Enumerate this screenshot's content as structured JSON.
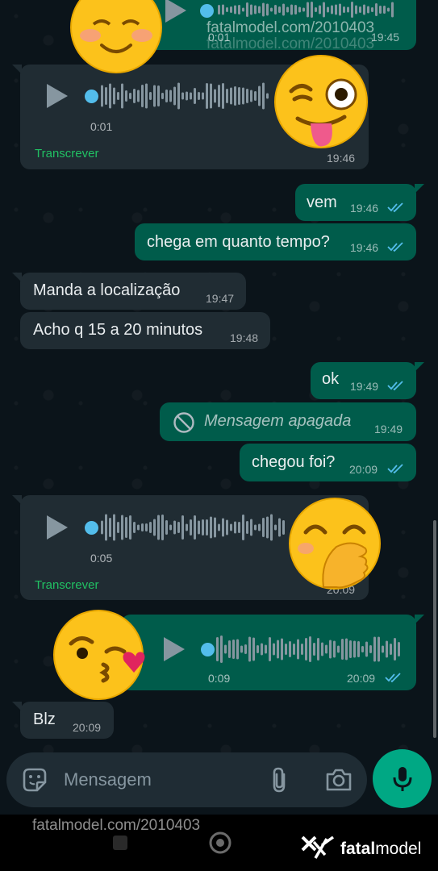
{
  "watermarks": {
    "top": "fatalmodel.com/2010403",
    "top_ghost": "fatalmodel.com/2010403",
    "bottom": "fatalmodel.com/2010403"
  },
  "messages": [
    {
      "kind": "voice",
      "dir": "out",
      "duration": "0:01",
      "time": "19:45",
      "partial": true
    },
    {
      "kind": "voice",
      "dir": "in",
      "duration": "0:01",
      "time": "19:46",
      "transcribe": "Transcrever"
    },
    {
      "kind": "text",
      "dir": "out",
      "text": "vem",
      "time": "19:46"
    },
    {
      "kind": "text",
      "dir": "out",
      "text": "chega em quanto tempo?",
      "time": "19:46"
    },
    {
      "kind": "text",
      "dir": "in",
      "text": "Manda a localização",
      "time": "19:47"
    },
    {
      "kind": "text",
      "dir": "in",
      "text": "Acho q 15 a 20 minutos",
      "time": "19:48"
    },
    {
      "kind": "text",
      "dir": "out",
      "text": "ok",
      "time": "19:49"
    },
    {
      "kind": "deleted",
      "dir": "out",
      "text": "Mensagem apagada",
      "time": "19:49"
    },
    {
      "kind": "text",
      "dir": "out",
      "text": "chegou foi?",
      "time": "20:09"
    },
    {
      "kind": "voice",
      "dir": "in",
      "duration": "0:05",
      "time": "20:09",
      "transcribe": "Transcrever"
    },
    {
      "kind": "voice",
      "dir": "out",
      "duration": "0:09",
      "time": "20:09"
    },
    {
      "kind": "text",
      "dir": "in",
      "text": "Blz",
      "time": "20:09"
    }
  ],
  "stickers": [
    "smiling-blush-emoji",
    "winking-tongue-emoji",
    "hand-over-mouth-emoji",
    "kissing-heart-emoji"
  ],
  "composer": {
    "placeholder": "Mensagem",
    "icons": [
      "sticker-icon",
      "attach-icon",
      "camera-icon",
      "mic-icon"
    ]
  },
  "brand": {
    "bold": "fatal",
    "regular": "model"
  },
  "colors": {
    "outgoing": "#005c4b",
    "incoming": "#202c33",
    "read_ticks": "#53bdeb",
    "accent": "#00a884",
    "transcribe_link": "#21c063"
  }
}
